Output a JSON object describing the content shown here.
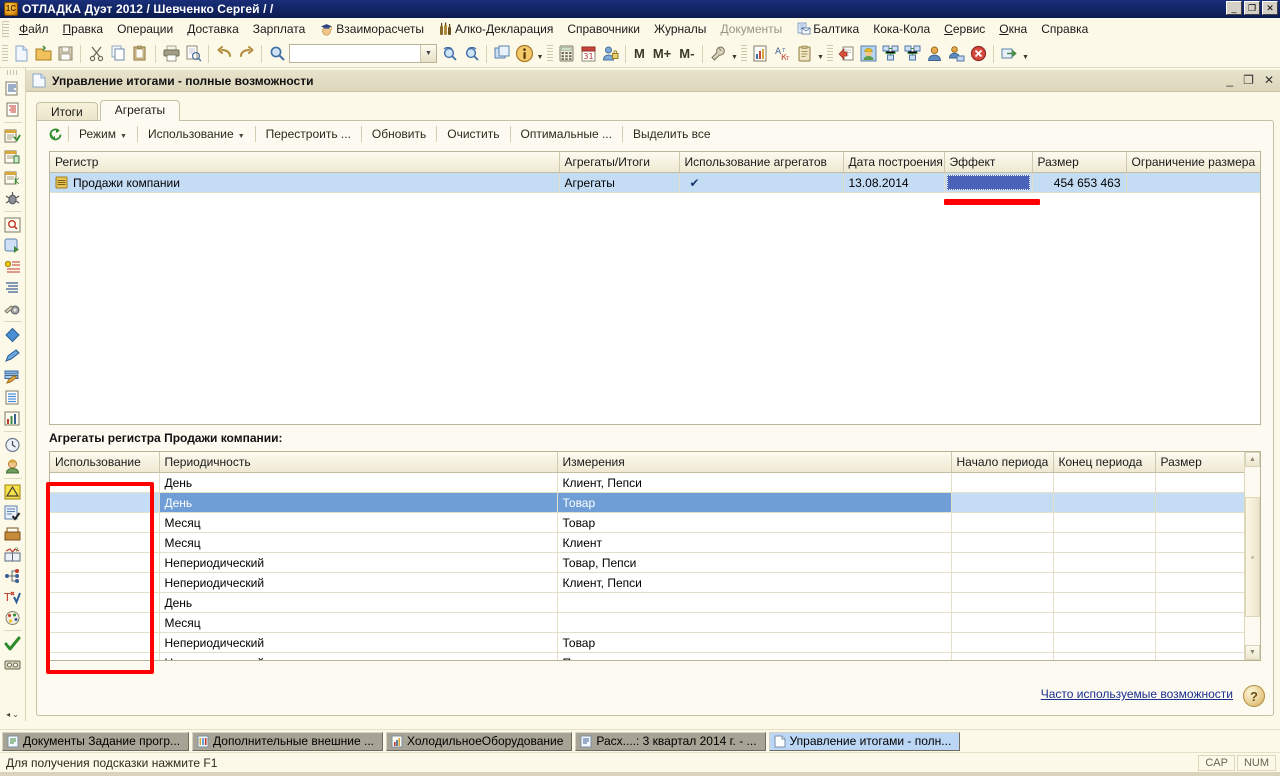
{
  "window": {
    "title": "ОТЛАДКА Дуэт 2012 / Шевченко Сергей /   /",
    "app_icon": "1c-logo-icon",
    "minimize": "_",
    "maximize": "❐",
    "close": "✕"
  },
  "menubar": {
    "items": [
      {
        "label": "Файл",
        "accel": "Ф",
        "icon": null,
        "disabled": false
      },
      {
        "label": "Правка",
        "accel": "П",
        "icon": null,
        "disabled": false
      },
      {
        "label": "Операции",
        "accel": null,
        "icon": null,
        "disabled": false
      },
      {
        "label": "Доставка",
        "accel": null,
        "icon": null,
        "disabled": false
      },
      {
        "label": "Зарплата",
        "accel": null,
        "icon": null,
        "disabled": false
      },
      {
        "label": "Взаиморасчеты",
        "accel": null,
        "icon": "graduate-icon",
        "disabled": false
      },
      {
        "label": "Алко-Декларация",
        "accel": null,
        "icon": "bottles-icon",
        "disabled": false
      },
      {
        "label": "Справочники",
        "accel": null,
        "icon": null,
        "disabled": false
      },
      {
        "label": "Журналы",
        "accel": null,
        "icon": null,
        "disabled": false
      },
      {
        "label": "Документы",
        "accel": null,
        "icon": null,
        "disabled": true
      },
      {
        "label": "Балтика",
        "accel": null,
        "icon": "mail-doc-icon",
        "disabled": false
      },
      {
        "label": "Кока-Кола",
        "accel": null,
        "icon": null,
        "disabled": false
      },
      {
        "label": "Сервис",
        "accel": "С",
        "icon": null,
        "disabled": false
      },
      {
        "label": "Окна",
        "accel": "О",
        "icon": null,
        "disabled": false
      },
      {
        "label": "Справка",
        "accel": null,
        "icon": null,
        "disabled": false
      }
    ]
  },
  "toolbar": {
    "search_value": "",
    "buttons": [
      "new-document-icon",
      "open-folder-icon",
      "save-icon",
      "cut-scissors-icon",
      "copy-icon",
      "paste-icon",
      "print-icon",
      "print-preview-icon",
      "undo-arrow-icon",
      "redo-arrow-icon",
      "find-magnifier-icon"
    ],
    "buttons_right": [
      "find-next-icon",
      "find-prev-icon",
      "windows-cascade-icon",
      "info-icon",
      "calculator-icon",
      "calendar-icon",
      "user-lock-icon"
    ],
    "memory": [
      "M",
      "M+",
      "M-"
    ],
    "buttons_tail": [
      "wrench-icon",
      "report-chart-icon",
      "spellcheck-icon",
      "clipboard-list-icon",
      "exchange-docs-icon",
      "worker-helmet-icon",
      "network-sync-icon",
      "network-sync2-icon",
      "user-icon",
      "user-network-icon",
      "stop-icon",
      "exit-arrow-icon"
    ]
  },
  "rail": {
    "icons_top": [
      "doc-lines-icon",
      "doc-indent-icon",
      "calendar-doc-green-icon",
      "calendar-doc-paste-icon",
      "calendar-doc-k-icon",
      "bug-debug-icon",
      "query-magnifier-icon",
      "window-run-icon",
      "list-star-icon",
      "list-lines-icon",
      "gear-pen-icon",
      "blue-diamond-icon",
      "pencil-blue-icon",
      "list-pencil-icon",
      "table-blue-icon",
      "chart-bars-icon",
      "clock-icon",
      "person-head-icon",
      "drafting-triangle-icon",
      "form-check-icon",
      "card-file-icon",
      "book-question-icon",
      "tree-nodes-icon",
      "spellcheck-tick-icon",
      "palette-icon",
      "green-check-icon",
      "tape-cassette-icon"
    ],
    "bottom": [
      "◂",
      "⌄"
    ]
  },
  "mdi": {
    "title": "Управление итогами - полные возможности",
    "minimize": "_",
    "restore": "❐",
    "close": "✕"
  },
  "tabs": [
    {
      "label": "Итоги",
      "active": false
    },
    {
      "label": "Агрегаты",
      "active": true
    }
  ],
  "commandbar": {
    "refresh_icon": "refresh-green-icon",
    "buttons": [
      {
        "label": "Режим",
        "caret": true
      },
      {
        "label": "Использование",
        "caret": true
      },
      {
        "label": "Перестроить ...",
        "caret": false
      },
      {
        "label": "Обновить",
        "caret": false
      },
      {
        "label": "Очистить",
        "caret": false
      },
      {
        "label": "Оптимальные ...",
        "caret": false
      },
      {
        "label": "Выделить все",
        "caret": false
      }
    ]
  },
  "grid_registers": {
    "columns": [
      "Регистр",
      "Агрегаты/Итоги",
      "Использование агрегатов",
      "Дата построения",
      "Эффект",
      "Размер",
      "Ограничение размера"
    ],
    "rows": [
      {
        "selected": true,
        "icon": "register-icon",
        "register": "Продажи компании",
        "aggregates_totals": "Агрегаты",
        "use_aggregates": "✔",
        "build_date": "13.08.2014",
        "effect": "",
        "effect_selected": true,
        "size": "454 653 463",
        "size_limit": ""
      }
    ]
  },
  "section": {
    "label": "Агрегаты регистра Продажи компании:"
  },
  "grid_aggregates": {
    "columns": [
      "Использование",
      "Периодичность",
      "Измерения",
      "Начало периода",
      "Конец периода",
      "Размер"
    ],
    "rows": [
      {
        "use": "",
        "period": "День",
        "dims": "Клиент, Пепси",
        "start": "",
        "end": "",
        "size": "",
        "selected": false
      },
      {
        "use": "",
        "period": "День",
        "dims": "Товар",
        "start": "",
        "end": "",
        "size": "",
        "selected": true
      },
      {
        "use": "",
        "period": "Месяц",
        "dims": "Товар",
        "start": "",
        "end": "",
        "size": "",
        "selected": false
      },
      {
        "use": "",
        "period": "Месяц",
        "dims": "Клиент",
        "start": "",
        "end": "",
        "size": "",
        "selected": false
      },
      {
        "use": "",
        "period": "Непериодический",
        "dims": "Товар, Пепси",
        "start": "",
        "end": "",
        "size": "",
        "selected": false
      },
      {
        "use": "",
        "period": "Непериодический",
        "dims": "Клиент, Пепси",
        "start": "",
        "end": "",
        "size": "",
        "selected": false
      },
      {
        "use": "",
        "period": "День",
        "dims": "",
        "start": "",
        "end": "",
        "size": "",
        "selected": false
      },
      {
        "use": "",
        "period": "Месяц",
        "dims": "",
        "start": "",
        "end": "",
        "size": "",
        "selected": false
      },
      {
        "use": "",
        "period": "Непериодический",
        "dims": "Товар",
        "start": "",
        "end": "",
        "size": "",
        "selected": false
      },
      {
        "use": "",
        "period": "Непериодический",
        "dims": "Пепси",
        "start": "",
        "end": "",
        "size": "",
        "selected": false
      }
    ],
    "scroll_up": "▲",
    "scroll_down": "▼"
  },
  "footer": {
    "link": "Часто используемые возможности",
    "help_button": "?"
  },
  "taskbar": {
    "items": [
      {
        "label": "Документы Задание progr...",
        "text": "Документы Задание прогр...",
        "icon": "doc-green-icon",
        "active": false
      },
      {
        "label": "Дополнительные внешние ...",
        "text": "Дополнительные внешние ...",
        "icon": "columns-icon",
        "active": false
      },
      {
        "label": "ХолодильноеОборудование",
        "text": "ХолодильноеОборудование",
        "icon": "chart-icon",
        "active": false
      },
      {
        "label": "Расх....: 3 квартал 2014 г. - ...",
        "text": "Расх....: 3 квартал 2014 г. - ...",
        "icon": "doc-blue-icon",
        "active": false
      },
      {
        "label": "Управление итогами - полн...",
        "text": "Управление итогами - полн...",
        "icon": "doc-white-icon",
        "active": true
      }
    ]
  },
  "statusbar": {
    "message": "Для получения подсказки нажмите F1",
    "indicators": [
      "CAP",
      "NUM"
    ]
  },
  "colors": {
    "title_bar": "#112463",
    "selection": "#c5dcf5",
    "row_selected": "#6f9ed6",
    "effect_cell": "#4a62b8",
    "annotation": "#ff0000",
    "background": "#fdf9e8",
    "link": "#1b2f8f"
  }
}
